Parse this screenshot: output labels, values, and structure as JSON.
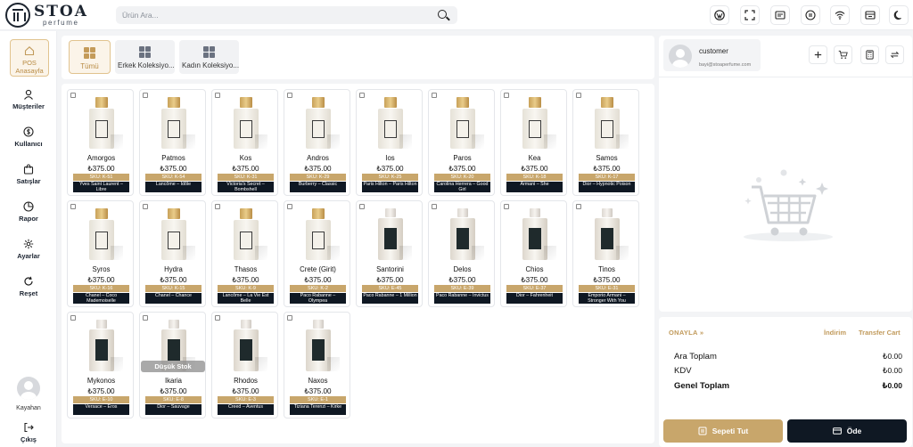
{
  "brand": {
    "name": "STOA",
    "tagline": "perfume"
  },
  "search": {
    "placeholder": "Ürün Ara..."
  },
  "topbar_icons": [
    "wordpress-icon",
    "fullscreen-icon",
    "receipt-icon",
    "pause-icon",
    "wifi-icon",
    "register-icon",
    "dark-mode-icon"
  ],
  "sidebar": {
    "items": [
      {
        "label": "POS Anasayfa",
        "icon": "home-icon"
      },
      {
        "label": "Müşteriler",
        "icon": "user-icon"
      },
      {
        "label": "Kullanıcı",
        "icon": "dollar-icon"
      },
      {
        "label": "Satışlar",
        "icon": "bag-icon"
      },
      {
        "label": "Rapor",
        "icon": "pie-chart-icon"
      },
      {
        "label": "Ayarlar",
        "icon": "gear-icon"
      },
      {
        "label": "Reşet",
        "icon": "refresh-icon"
      }
    ],
    "user_name": "Kayahan",
    "logout_label": "Çıkış"
  },
  "categories": [
    {
      "label": "Tümü",
      "active": true
    },
    {
      "label": "Erkek Koleksiyo...",
      "active": false
    },
    {
      "label": "Kadın Koleksiyo...",
      "active": false
    }
  ],
  "products": [
    {
      "name": "Amorgos",
      "price": "₺375.00",
      "sku": "SKU: K-51",
      "note": "Yves Saint Laurent – Libre",
      "bottle": "gold"
    },
    {
      "name": "Patmos",
      "price": "₺375.00",
      "sku": "SKU: K-54",
      "note": "Lancôme – Idôle",
      "bottle": "gold"
    },
    {
      "name": "Kos",
      "price": "₺375.00",
      "sku": "SKU: K-31",
      "note": "Victoria's Secret – Bombshell",
      "bottle": "gold"
    },
    {
      "name": "Andros",
      "price": "₺375.00",
      "sku": "SKU: K-29",
      "note": "Burberry – Classic",
      "bottle": "gold"
    },
    {
      "name": "Ios",
      "price": "₺375.00",
      "sku": "SKU: K-25",
      "note": "Paris Hilton – Paris Hilton",
      "bottle": "gold"
    },
    {
      "name": "Paros",
      "price": "₺375.00",
      "sku": "SKU: K-20",
      "note": "Carolina Herrera – Good Girl",
      "bottle": "gold"
    },
    {
      "name": "Kea",
      "price": "₺375.00",
      "sku": "SKU: K-18",
      "note": "Armani – She",
      "bottle": "gold"
    },
    {
      "name": "Samos",
      "price": "₺375.00",
      "sku": "SKU: K-17",
      "note": "Dior – Hypnotic Poison",
      "bottle": "gold"
    },
    {
      "name": "Syros",
      "price": "₺375.00",
      "sku": "SKU: K-16",
      "note": "Chanel – Coco Mademoiselle",
      "bottle": "gold"
    },
    {
      "name": "Hydra",
      "price": "₺375.00",
      "sku": "SKU: K-15",
      "note": "Chanel – Chance",
      "bottle": "gold"
    },
    {
      "name": "Thasos",
      "price": "₺375.00",
      "sku": "SKU: K-9",
      "note": "Lancôme – La Vie Est Belle",
      "bottle": "gold"
    },
    {
      "name": "Crete (Girit)",
      "price": "₺375.00",
      "sku": "SKU: K-2",
      "note": "Paco Rabanne – Olympea",
      "bottle": "gold"
    },
    {
      "name": "Santorini",
      "price": "₺375.00",
      "sku": "SKU: E-45",
      "note": "Paco Rabanne – 1 Million",
      "bottle": "dark"
    },
    {
      "name": "Delos",
      "price": "₺375.00",
      "sku": "SKU: E-39",
      "note": "Paco Rabanne – Invictus",
      "bottle": "dark"
    },
    {
      "name": "Chios",
      "price": "₺375.00",
      "sku": "SKU: E-37",
      "note": "Dior – Fahrenheit",
      "bottle": "dark"
    },
    {
      "name": "Tinos",
      "price": "₺375.00",
      "sku": "SKU: E-31",
      "note": "Emporio Armani – Stronger With You",
      "bottle": "dark"
    },
    {
      "name": "Mykonos",
      "price": "₺375.00",
      "sku": "SKU: E-10",
      "note": "Versace – Eros",
      "bottle": "dark"
    },
    {
      "name": "Ikaria",
      "price": "₺375.00",
      "sku": "SKU: E-8",
      "note": "Dior – Sauvage",
      "bottle": "dark",
      "badge": "Düşük Stok"
    },
    {
      "name": "Rhodos",
      "price": "₺375.00",
      "sku": "SKU: E-3",
      "note": "Creed – Aventus",
      "bottle": "dark"
    },
    {
      "name": "Naxos",
      "price": "₺375.00",
      "sku": "SKU: E-1",
      "note": "Tiziana Terenzi – Kirke",
      "bottle": "dark"
    }
  ],
  "cart": {
    "customer_name": "customer",
    "customer_email": "bayi@stoaperfume.com",
    "actions": [
      "plus-icon",
      "cart-icon",
      "calculator-icon",
      "swap-icon"
    ]
  },
  "summary": {
    "confirm_label": "ONAYLA",
    "discount_label": "İndirim",
    "transfer_label": "Transfer Cart",
    "subtotal_label": "Ara Toplam",
    "subtotal_value": "₺0.00",
    "tax_label": "KDV",
    "tax_value": "₺0.00",
    "total_label": "Genel Toplam",
    "total_value": "₺0.00",
    "hold_label": "Sepeti Tut",
    "pay_label": "Öde"
  },
  "colors": {
    "accent": "#c8a66b",
    "dark": "#0f1823"
  }
}
